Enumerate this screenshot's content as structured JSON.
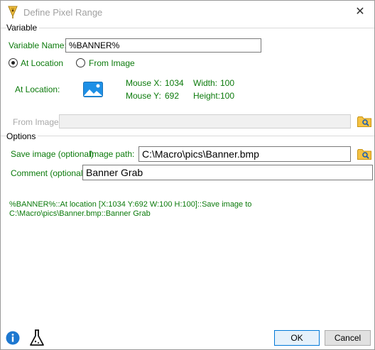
{
  "window": {
    "title": "Define Pixel Range"
  },
  "variable_section": {
    "label": "Variable",
    "name_label": "Variable Name:",
    "name_value": "%BANNER%",
    "radio_at_location": "At Location",
    "radio_from_image": "From Image",
    "selected": "At Location",
    "at_location_label": "At Location:",
    "mouse_x_label": "Mouse X:",
    "mouse_x_value": "1034",
    "mouse_y_label": "Mouse Y:",
    "mouse_y_value": "692",
    "width_label": "Width:",
    "width_value": "100",
    "height_label": "Height:",
    "height_value": "100",
    "from_image_label": "From Image:",
    "from_image_value": ""
  },
  "options_section": {
    "label": "Options",
    "save_image_label": "Save image (optional)",
    "image_path_label": "Image path:",
    "image_path_value": "C:\\Macro\\pics\\Banner.bmp",
    "comment_label": "Comment (optional):",
    "comment_value": "Banner Grab"
  },
  "summary": "%BANNER%::At location [X:1034 Y:692 W:100 H:100]::Save image to C:\\Macro\\pics\\Banner.bmp::Banner Grab",
  "buttons": {
    "ok": "OK",
    "cancel": "Cancel"
  },
  "icons": {
    "app": "pen-nib-icon",
    "picture": "image-icon",
    "browse": "folder-search-icon",
    "info": "info-icon",
    "test": "flask-icon",
    "close": "close-icon"
  },
  "colors": {
    "label_green": "#0b7a0b",
    "info_blue": "#1e78d0",
    "folder_yellow": "#f5c242",
    "ok_border": "#0078d7"
  }
}
